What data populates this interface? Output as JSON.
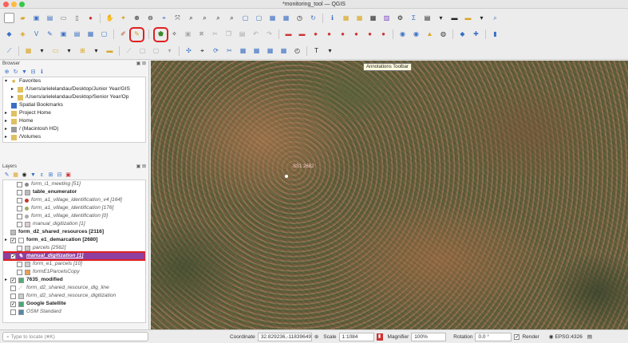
{
  "window": {
    "title": "*monitoring_tool — QGIS"
  },
  "tooltip": "Annotations Toolbar",
  "map": {
    "point_label": "SS1 2682"
  },
  "browser": {
    "title": "Browser",
    "items": [
      {
        "label": "Favorites",
        "level": 0,
        "expander": "▾",
        "icon": "star-icon"
      },
      {
        "label": "/Users/arielelandau/Desktop/Junior Year/GIS",
        "level": 1,
        "expander": "▸",
        "icon": "folder-icon"
      },
      {
        "label": "/Users/arielelandau/Desktop/Senior Year/Op",
        "level": 1,
        "expander": "▸",
        "icon": "folder-icon"
      },
      {
        "label": "Spatial Bookmarks",
        "level": 0,
        "expander": "",
        "icon": "bookmark-icon"
      },
      {
        "label": "Project Home",
        "level": 0,
        "expander": "▸",
        "icon": "folder-icon"
      },
      {
        "label": "Home",
        "level": 0,
        "expander": "▸",
        "icon": "folder-icon"
      },
      {
        "label": "/ (Macintosh HD)",
        "level": 0,
        "expander": "▸",
        "icon": "drive-icon"
      },
      {
        "label": "/Volumes",
        "level": 0,
        "expander": "▸",
        "icon": "folder-icon"
      }
    ]
  },
  "layers": {
    "title": "Layers",
    "items": [
      {
        "label": "form_i1_meeting [51]",
        "style": "ital",
        "checked": false,
        "expander": "",
        "indent": 1,
        "icon": "point-icon",
        "color": "#888"
      },
      {
        "label": "table_enumerator",
        "style": "bold",
        "checked": false,
        "expander": "",
        "indent": 1,
        "icon": "table-icon",
        "color": "#bbb"
      },
      {
        "label": "form_a1_village_identification_v4 [164]",
        "style": "ital",
        "checked": false,
        "expander": "",
        "indent": 1,
        "icon": "point-icon",
        "color": "#c0392b"
      },
      {
        "label": "form_a1_village_identification [176]",
        "style": "ital",
        "checked": false,
        "expander": "",
        "indent": 1,
        "icon": "point-icon",
        "color": "#9a6"
      },
      {
        "label": "form_a1_village_identification [0]",
        "style": "ital",
        "checked": false,
        "expander": "",
        "indent": 1,
        "icon": "point-icon",
        "color": "#aaa"
      },
      {
        "label": "manual_digitization [1]",
        "style": "ital",
        "checked": false,
        "expander": "",
        "indent": 1,
        "icon": "polygon-icon",
        "color": "#dcc"
      },
      {
        "label": "form_d2_shared_resources [2116]",
        "style": "bold",
        "checked": null,
        "expander": "",
        "indent": 0,
        "icon": "table-icon",
        "color": "#bbb"
      },
      {
        "label": "form_e1_demarcation [2680]",
        "style": "bold",
        "checked": true,
        "expander": "▸",
        "indent": 0,
        "icon": "polygon-icon",
        "color": "#fff"
      },
      {
        "label": "parcels [2562]",
        "style": "ital",
        "checked": false,
        "expander": "",
        "indent": 1,
        "icon": "polygon-icon",
        "color": "#ccc"
      },
      {
        "label": "manual_digitization [1]",
        "style": "selected",
        "checked": true,
        "expander": "",
        "indent": 0,
        "icon": "pencil-icon",
        "color": "#e8d"
      },
      {
        "label": "form_e1_parcels [10]",
        "style": "ital",
        "checked": false,
        "expander": "",
        "indent": 1,
        "icon": "polygon-icon",
        "color": "#ccc"
      },
      {
        "label": "formE1ParcelsCopy",
        "style": "ital",
        "checked": false,
        "expander": "",
        "indent": 1,
        "icon": "polygon-icon",
        "color": "#e9a050"
      },
      {
        "label": "7635_modified",
        "style": "bold",
        "checked": true,
        "expander": "▸",
        "indent": 0,
        "icon": "raster-icon",
        "color": "#5a7"
      },
      {
        "label": "form_d2_shared_resource_dig_line",
        "style": "ital",
        "checked": false,
        "expander": "",
        "indent": 0,
        "icon": "line-icon",
        "color": "#999"
      },
      {
        "label": "form_d2_shared_resource_digitization",
        "style": "ital",
        "checked": false,
        "expander": "",
        "indent": 0,
        "icon": "polygon-icon",
        "color": "#ccc"
      },
      {
        "label": "Google Satellite",
        "style": "bold",
        "checked": true,
        "expander": "",
        "indent": 0,
        "icon": "raster-icon",
        "color": "#4a7"
      },
      {
        "label": "OSM Standard",
        "style": "ital",
        "checked": false,
        "expander": "",
        "indent": 0,
        "icon": "raster-icon",
        "color": "#58a"
      }
    ]
  },
  "status": {
    "locate_placeholder": "Type to locate (⌘K)",
    "coord_label": "Coordinate",
    "coord_value": "32.829236,-11839649",
    "scale_label": "Scale",
    "scale_value": "1:1084",
    "magnifier_label": "Magnifier",
    "magnifier_value": "100%",
    "rotation_label": "Rotation",
    "rotation_value": "0.0 °",
    "render_label": "Render",
    "crs": "EPSG:4326"
  }
}
